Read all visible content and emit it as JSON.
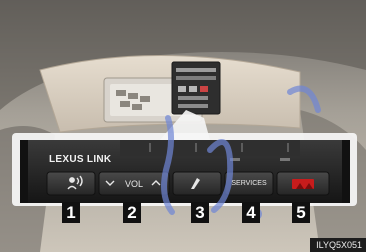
{
  "panel": {
    "brand_label": "LEXUS LINK",
    "buttons": [
      {
        "number": "1",
        "label": "",
        "icon": "voice-command-icon"
      },
      {
        "number": "2",
        "label": "VOL",
        "icon": "chevron-down-up-icon"
      },
      {
        "number": "3",
        "label": "",
        "icon": "phone-icon"
      },
      {
        "number": "4",
        "label": "SERVICES",
        "icon": ""
      },
      {
        "number": "5",
        "label": "",
        "icon": "sos-icon"
      }
    ]
  },
  "image_code": "ILYQ5X051",
  "colors": {
    "headliner": "#d9cfc0",
    "panel": "#2a2a2a",
    "button": "#3a3a3a",
    "sos_red": "#d11a1a",
    "watermark_blue": "#6f86d6"
  }
}
